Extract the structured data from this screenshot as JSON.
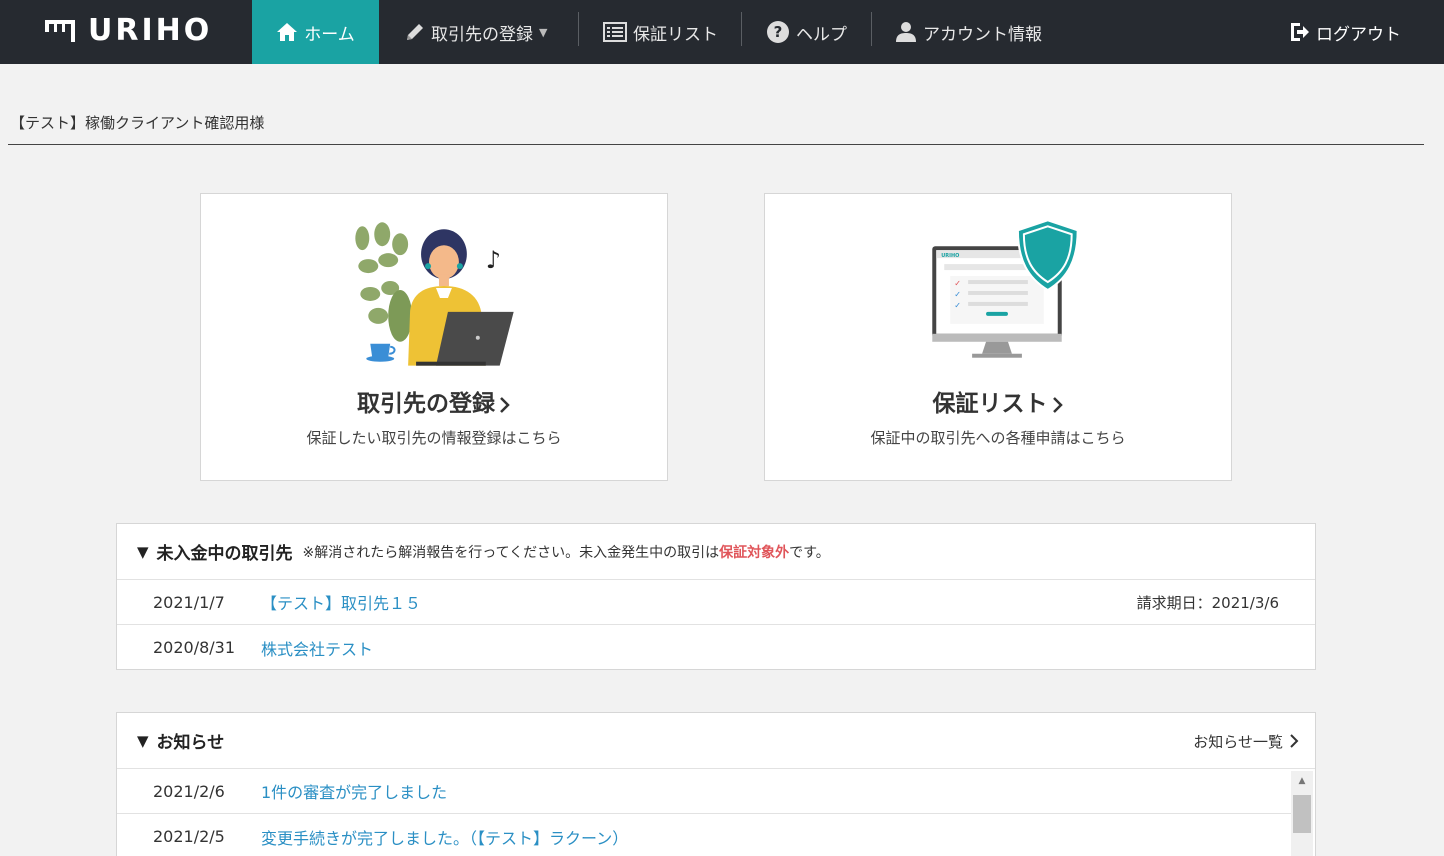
{
  "nav": {
    "logo": "URIHO",
    "home": "ホーム",
    "register": "取引先の登録",
    "guarantee_list": "保証リスト",
    "help": "ヘルプ",
    "account": "アカウント情報",
    "logout": "ログアウト"
  },
  "client_name": "【テスト】稼働クライアント確認用様",
  "cards": {
    "register": {
      "title": "取引先の登録",
      "desc": "保証したい取引先の情報登録はこちら"
    },
    "guarantee": {
      "title": "保証リスト",
      "desc": "保証中の取引先への各種申請はこちら",
      "screen_logo": "URIHO"
    }
  },
  "unpaid": {
    "title": "未入金中の取引先",
    "note_prefix": "※解消されたら解消報告を行ってください。未入金発生中の取引は",
    "note_warn": "保証対象外",
    "note_suffix": "です。",
    "rows": [
      {
        "date": "2021/1/7",
        "name": "【テスト】取引先１５",
        "due": "請求期日：2021/3/6"
      },
      {
        "date": "2020/8/31",
        "name": "株式会社テスト",
        "due": ""
      }
    ]
  },
  "news": {
    "title": "お知らせ",
    "more": "お知らせ一覧",
    "rows": [
      {
        "date": "2021/2/6",
        "text": "1件の審査が完了しました"
      },
      {
        "date": "2021/2/5",
        "text": "変更手続きが完了しました。（【テスト】ラクーン）"
      }
    ]
  },
  "colors": {
    "nav_bg": "#262a30",
    "accent": "#1aa3a3",
    "link": "#2a8fc4",
    "warn": "#e0555a"
  }
}
